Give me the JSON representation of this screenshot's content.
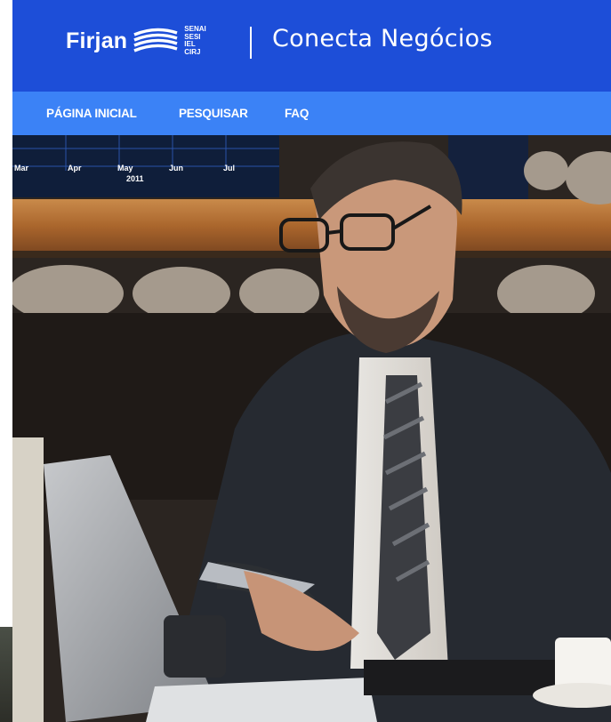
{
  "header": {
    "logo_text": "Firjan",
    "logo_sub": [
      "SENAI",
      "SESI",
      "IEL",
      "CIRJ"
    ],
    "app_title": "Conecta Negócios",
    "brand_color": "#1d4ed8"
  },
  "nav": {
    "bg_color": "#3b82f6",
    "items": [
      "PÁGINA INICIAL",
      "PESQUISAR",
      "FAQ"
    ]
  },
  "hero": {
    "chart_labels": [
      "Mar",
      "Apr",
      "May",
      "Jun",
      "Jul",
      "2011"
    ]
  }
}
